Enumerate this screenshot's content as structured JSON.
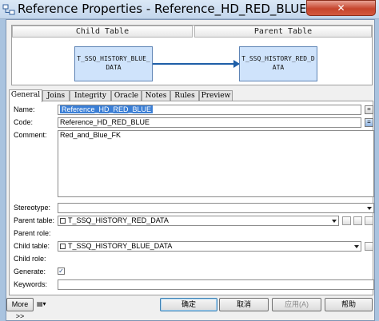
{
  "window": {
    "title": "Reference Properties - Reference_HD_RED_BLUE (Ref..."
  },
  "diagram": {
    "child_header": "Child Table",
    "parent_header": "Parent Table",
    "child_table": "T_SSQ_HISTORY_BLUE_DATA",
    "parent_table": "T_SSQ_HISTORY_RED_DATA"
  },
  "tabs": [
    {
      "label": "General",
      "active": true
    },
    {
      "label": "Joins"
    },
    {
      "label": "Integrity"
    },
    {
      "label": "Oracle"
    },
    {
      "label": "Notes"
    },
    {
      "label": "Rules"
    },
    {
      "label": "Preview"
    }
  ],
  "form": {
    "name_label": "Name:",
    "name_value": "Reference_HD_RED_BLUE",
    "code_label": "Code:",
    "code_value": "Reference_HD_RED_BLUE",
    "comment_label": "Comment:",
    "comment_value": "Red_and_Blue_FK",
    "stereotype_label": "Stereotype:",
    "stereotype_value": "",
    "parent_table_label": "Parent table:",
    "parent_table_value": "T_SSQ_HISTORY_RED_DATA",
    "parent_role_label": "Parent role:",
    "child_table_label": "Child table:",
    "child_table_value": "T_SSQ_HISTORY_BLUE_DATA",
    "child_role_label": "Child role:",
    "generate_label": "Generate:",
    "generate_checked": "✓",
    "keywords_label": "Keywords:"
  },
  "buttons": {
    "more": "More >>",
    "ok": "确定",
    "cancel": "取消",
    "apply": "应用(A)",
    "help": "帮助",
    "equals": "="
  }
}
